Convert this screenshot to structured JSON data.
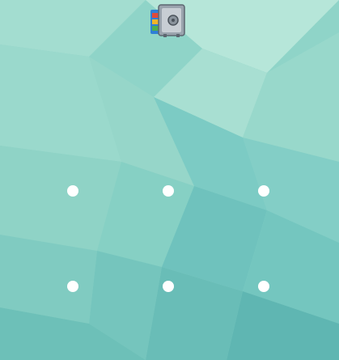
{
  "app": {
    "icon": "vault-safe-icon"
  },
  "colors": {
    "wallpaper_base": "#8fd4c8",
    "dot": "#ffffff"
  },
  "pattern_lock": {
    "dots": [
      {
        "id": 1,
        "state": "idle"
      },
      {
        "id": 2,
        "state": "idle"
      },
      {
        "id": 3,
        "state": "idle"
      },
      {
        "id": 4,
        "state": "idle"
      },
      {
        "id": 5,
        "state": "idle"
      },
      {
        "id": 6,
        "state": "idle"
      }
    ]
  }
}
